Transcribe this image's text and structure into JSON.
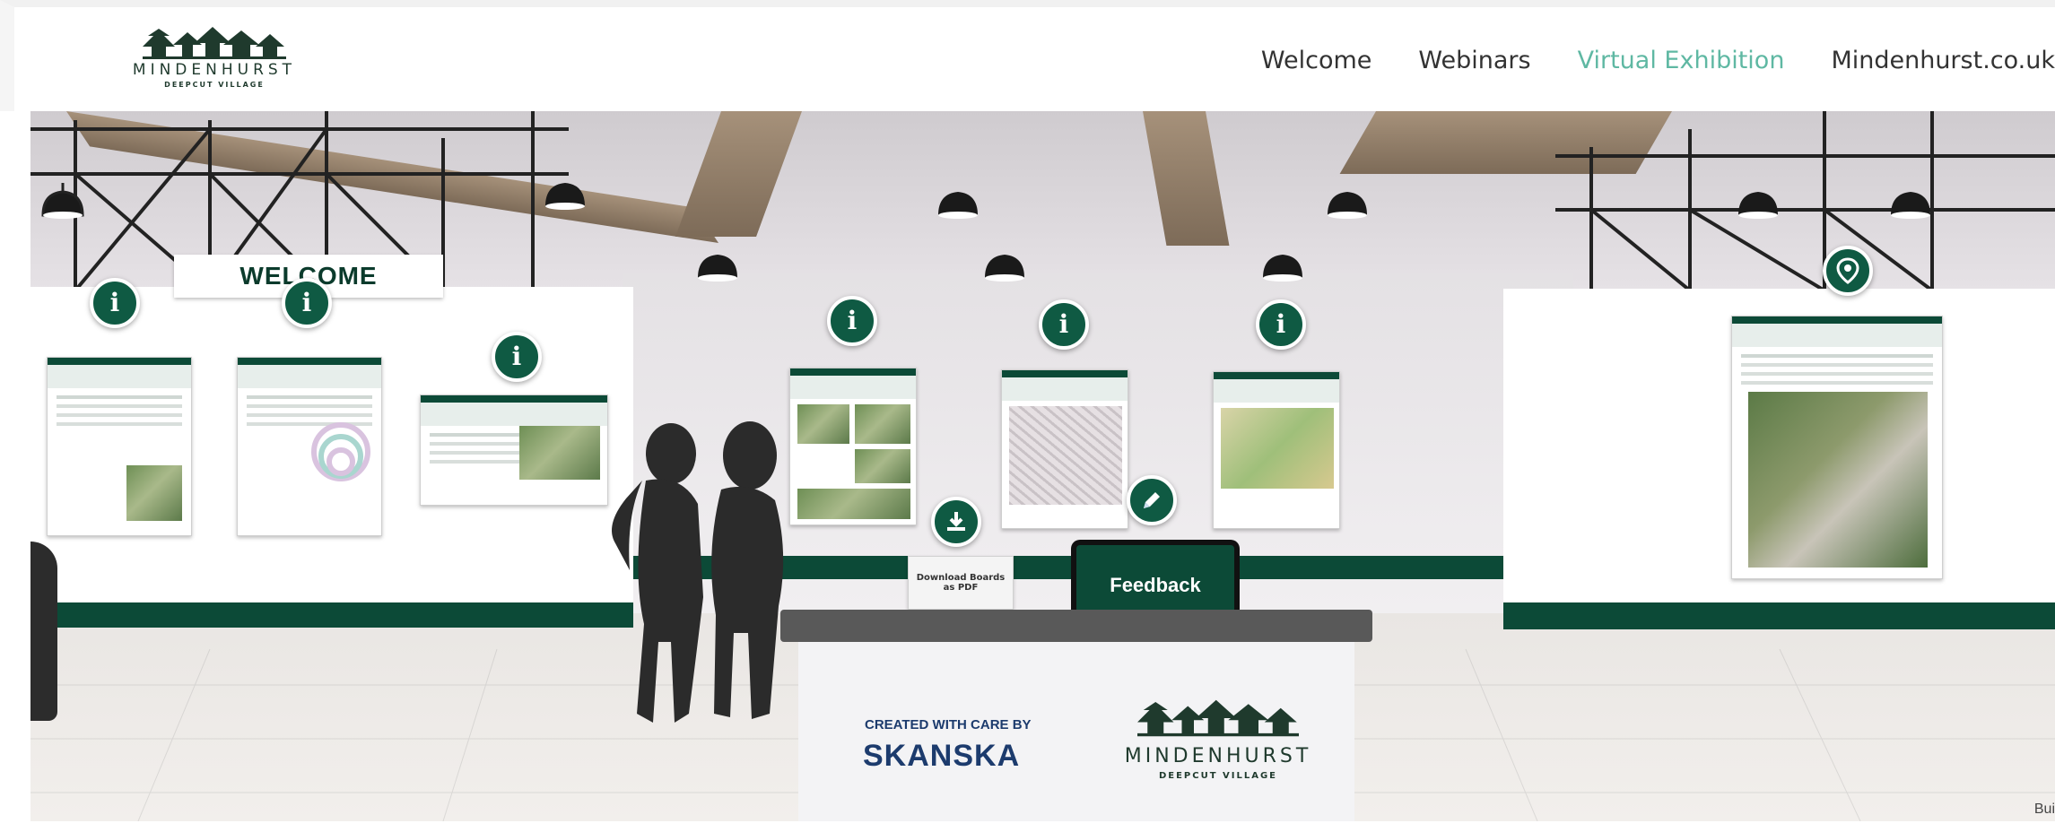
{
  "header": {
    "logo": {
      "name": "MINDENHURST",
      "tagline": "DEEPCUT VILLAGE"
    },
    "nav": [
      {
        "label": "Welcome",
        "active": false
      },
      {
        "label": "Webinars",
        "active": false
      },
      {
        "label": "Virtual Exhibition",
        "active": true
      },
      {
        "label": "Mindenhurst.co.uk",
        "active": false
      }
    ],
    "colors": {
      "nav_active": "#5fb8a3",
      "nav_text": "#333333",
      "brand_green": "#0c4a37"
    }
  },
  "scene": {
    "welcome_sign": "WELCOME",
    "hotspots": {
      "info_icon": "info-icon",
      "location_icon": "map-pin-icon",
      "download_icon": "download-icon",
      "edit_icon": "pencil-icon"
    },
    "download_label": "Download Boards as PDF",
    "feedback_label": "Feedback",
    "desk": {
      "created_by": "CREATED WITH CARE BY",
      "sponsor": "SKANSKA",
      "logo_name": "MINDENHURST",
      "logo_tagline": "DEEPCUT VILLAGE"
    },
    "footer_partial": "Bui"
  }
}
